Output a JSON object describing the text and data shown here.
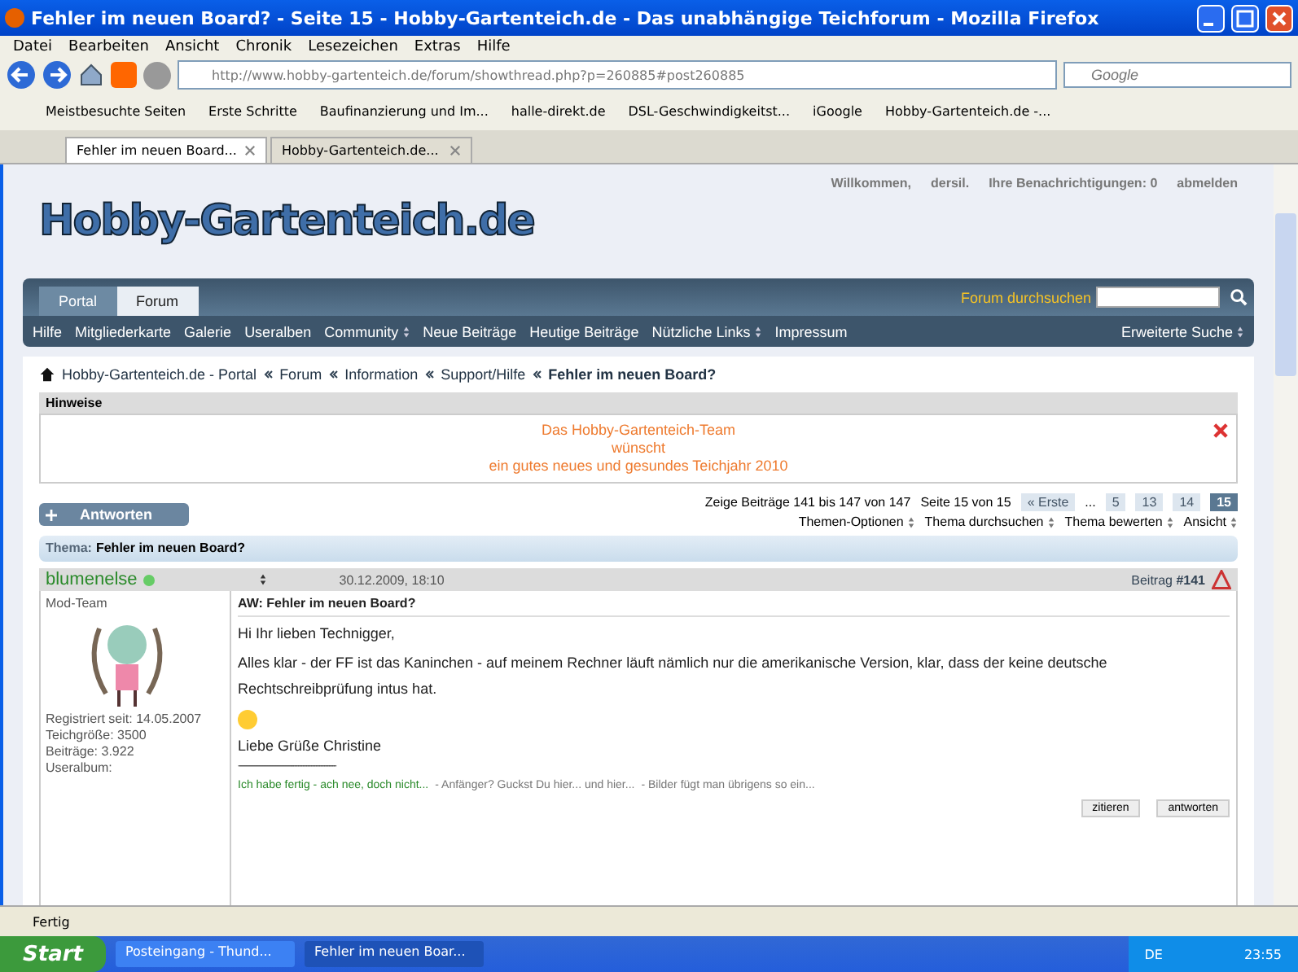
{
  "window": {
    "title": "Fehler im neuen Board? - Seite 15 - Hobby-Gartenteich.de - Das unabhängige Teichforum - Mozilla Firefox"
  },
  "menu": [
    "Datei",
    "Bearbeiten",
    "Ansicht",
    "Chronik",
    "Lesezeichen",
    "Extras",
    "Hilfe"
  ],
  "address": {
    "value": "http://www.hobby-gartenteich.de/forum/showthread.php?p=260885#post260885"
  },
  "search": {
    "placeholder": "Google"
  },
  "bookmarks": [
    "Meistbesuchte Seiten",
    "Erste Schritte",
    "Baufinanzierung und Im...",
    "halle-direkt.de",
    "DSL-Geschwindigkeitst...",
    "iGoogle",
    "Hobby-Gartenteich.de -..."
  ],
  "tabs": [
    {
      "label": "Fehler im neuen Board...",
      "selected": true
    },
    {
      "label": "Hobby-Gartenteich.de...",
      "selected": false
    }
  ],
  "site": {
    "logo": "Hobby-Gartenteich.de",
    "user_links": [
      "Willkommen,",
      "dersil.",
      "Ihre Benachrichtigungen: 0",
      "abmelden"
    ],
    "top_tabs": [
      {
        "label": "Portal",
        "selected": false
      },
      {
        "label": "Forum",
        "selected": true
      }
    ],
    "search_label": "Forum durchsuchen",
    "nav": [
      {
        "label": "Hilfe",
        "dropdown": false
      },
      {
        "label": "Mitgliederkarte",
        "dropdown": false
      },
      {
        "label": "Galerie",
        "dropdown": false
      },
      {
        "label": "Useralben",
        "dropdown": false
      },
      {
        "label": "Community",
        "dropdown": true
      },
      {
        "label": "Neue Beiträge",
        "dropdown": false
      },
      {
        "label": "Heutige Beiträge",
        "dropdown": false
      },
      {
        "label": "Nützliche Links",
        "dropdown": true
      },
      {
        "label": "Impressum",
        "dropdown": false
      }
    ],
    "advanced_search": "Erweiterte Suche",
    "breadcrumb": [
      "Hobby-Gartenteich.de - Portal",
      "Forum",
      "Information",
      "Support/Hilfe"
    ],
    "breadcrumb_current": "Fehler im neuen Board?",
    "notice": {
      "title": "Hinweise",
      "lines": [
        "Das Hobby-Gartenteich-Team",
        "wünscht",
        "ein gutes neues und gesundes Teichjahr 2010"
      ]
    },
    "reply_button": "Antworten",
    "pagination": {
      "summary": "Zeige Beiträge 141 bis 147 von 147",
      "page_of": "Seite 15 von 15",
      "pages": [
        {
          "label": "« Erste",
          "selected": false
        },
        {
          "label": "5",
          "selected": false
        },
        {
          "label": "13",
          "selected": false
        },
        {
          "label": "14",
          "selected": false
        },
        {
          "label": "15",
          "selected": true
        }
      ],
      "ellipsis": "..."
    },
    "thread_tools": [
      "Themen-Optionen",
      "Thema durchsuchen",
      "Thema bewerten",
      "Ansicht"
    ],
    "thread_label": "Thema:",
    "thread_title": "Fehler im neuen Board?",
    "post": {
      "author": "blumenelse",
      "online": true,
      "date": "30.12.2009, 18:10",
      "number_label": "Beitrag",
      "number": "#141",
      "rank": "Mod-Team",
      "user_info": [
        [
          "Registriert seit:",
          "14.05.2007"
        ],
        [
          "Teichgröße:",
          "3500"
        ],
        [
          "Beiträge:",
          "3.922"
        ]
      ],
      "album": "Useralbum:",
      "title": "AW: Fehler im neuen Board?",
      "greeting": "Hi Ihr lieben Technigger,",
      "body": "Alles klar - der FF ist das Kaninchen - auf meinem Rechner läuft nämlich nur die amerikanische Version, klar, dass der keine deutsche Rechtschreibprüfung intus hat.",
      "signature": "Liebe Grüße Christine",
      "sig_rule": "------------------------------------------------------------",
      "sig_links": [
        "Ich habe fertig - ach nee, doch nicht...",
        "- Anfänger? Guckst Du hier... und hier...",
        "- Bilder fügt man übrigens so ein..."
      ],
      "actions": [
        "zitieren",
        "antworten"
      ]
    }
  },
  "status_bar": "Fertig",
  "taskbar": {
    "start": "Start",
    "tasks": [
      {
        "label": "Posteingang - Thund...",
        "selected": false
      },
      {
        "label": "Fehler im neuen Boar...",
        "selected": true
      }
    ],
    "lang": "DE",
    "clock": "23:55"
  }
}
